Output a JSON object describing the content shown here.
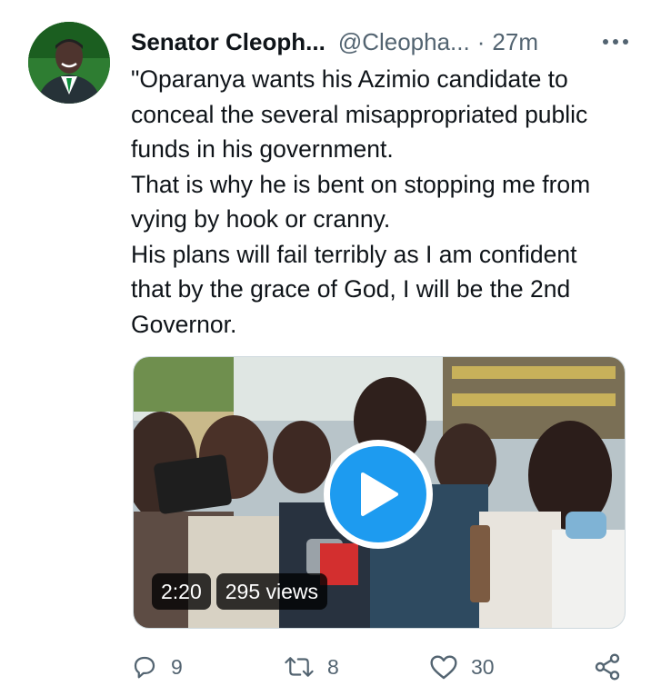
{
  "tweet": {
    "author_name": "Senator Cleoph...",
    "handle": "@Cleopha...",
    "separator": "·",
    "time": "27m",
    "text": "\"Oparanya wants his Azimio candidate to\nconceal the several misappropriated public\nfunds in his government.\nThat is why he is bent on stopping me from\nvying by hook or cranny.\nHis plans will fail terribly as I am confident\nthat by the grace of God, I will be the 2nd\nGovernor."
  },
  "video": {
    "duration": "2:20",
    "views": "295 views"
  },
  "actions": {
    "replies": "9",
    "retweets": "8",
    "likes": "30"
  },
  "icons": [
    "more-icon",
    "play-icon",
    "reply-icon",
    "retweet-icon",
    "like-icon",
    "share-icon"
  ],
  "colors": {
    "accent": "#1d9bf0",
    "muted": "#536471",
    "text": "#0f1419"
  }
}
